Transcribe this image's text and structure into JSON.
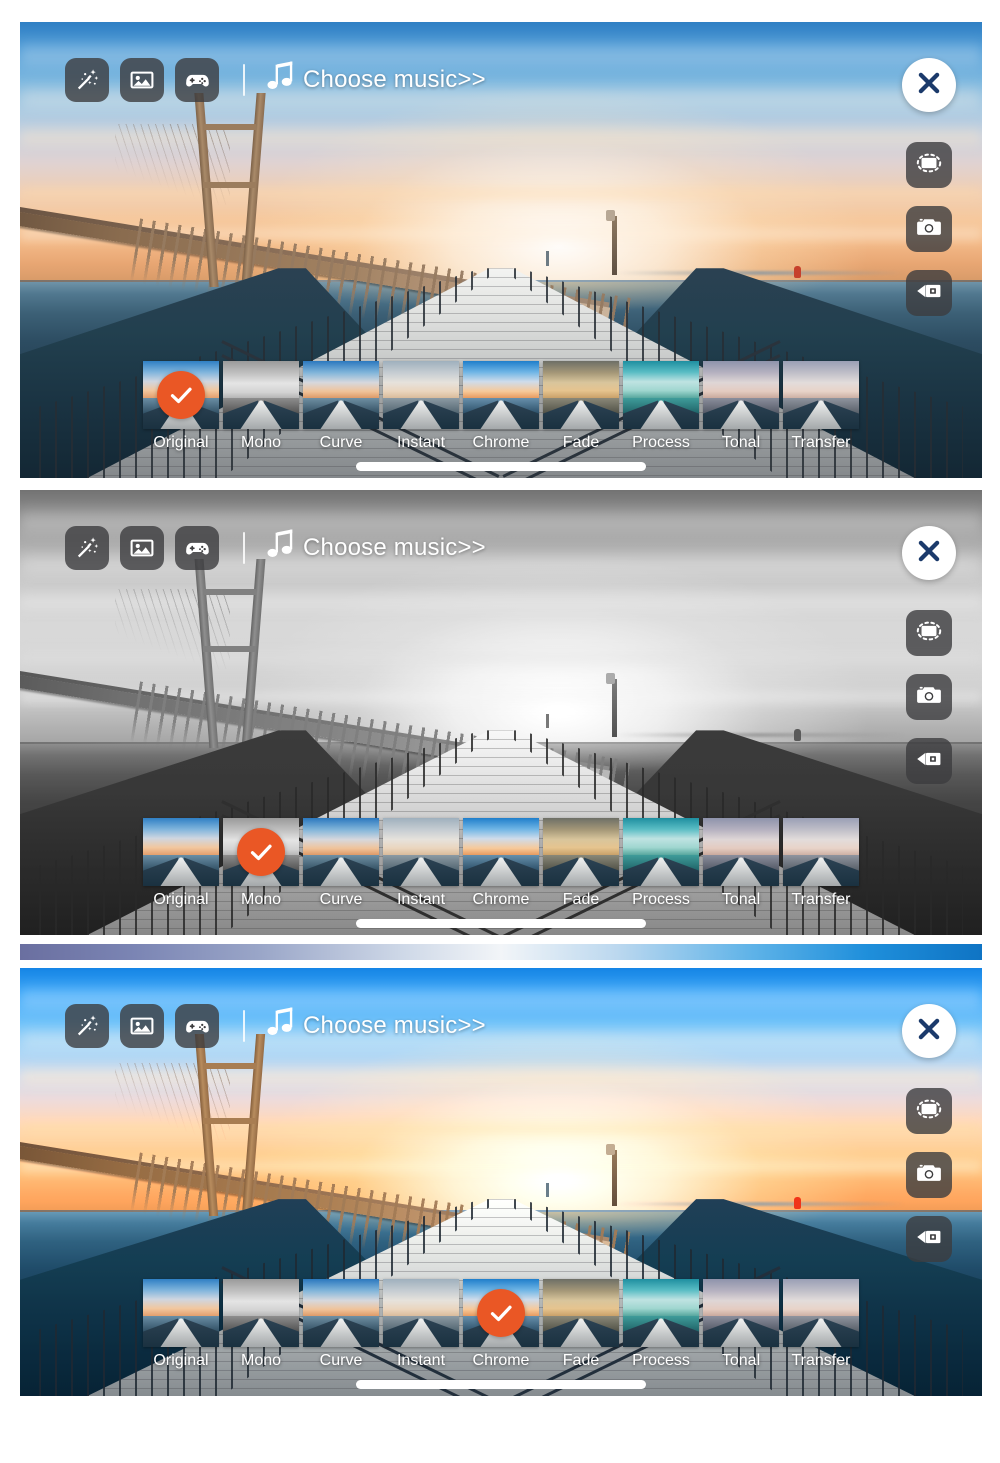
{
  "app": {
    "title": "Video Editor Filter Picker",
    "accent_orange": "#ea5725",
    "close_mark_color": "#1b3a6b",
    "button_bg": "rgba(60,60,62,0.80)"
  },
  "toolbar": {
    "magic_label": "magic-wand",
    "photo_label": "photo",
    "game_label": "game-controller",
    "divider": "|",
    "music_note": "music-note",
    "music_label": "Choose music>>"
  },
  "sidebar": {
    "close_label": "close",
    "rotate_label": "rotate",
    "camera_label": "camera",
    "video_label": "video-camera"
  },
  "filters": {
    "items": [
      {
        "label": "Original",
        "sky": "linear-gradient(180deg,#2f7fc4,#7fb4dc 30%,#cfd6e0 55%,#f2c79e 80%,#e39f6d 100%)",
        "sea": "linear-gradient(180deg,#6a8ea5,#2b4a5e 55%,#182d3c)"
      },
      {
        "label": "Mono",
        "sky": "linear-gradient(180deg,#9a9a9a,#c3c3c3 35%,#e4e4e4 60%,#d2d2d2 85%,#b5b5b5 100%)",
        "sea": "linear-gradient(180deg,#8e8e8e,#4c4c4c 55%,#2c2c2c)"
      },
      {
        "label": "Curve",
        "sky": "linear-gradient(180deg,#2b78bf,#83b6da 32%,#d6d8dd 58%,#f0c39a 82%,#dd9a68 100%)",
        "sea": "linear-gradient(180deg,#6f8fa3,#2c4a5c 55%,#1a2f3d)"
      },
      {
        "label": "Instant",
        "sky": "linear-gradient(180deg,#9fb0bd,#c6cdd2 32%,#e6e2dc 58%,#ead5bd 82%,#d9bb9c 100%)",
        "sea": "linear-gradient(180deg,#8c9aa3,#4b5f6b 55%,#30424d)"
      },
      {
        "label": "Chrome",
        "sky": "linear-gradient(180deg,#1f7ecb,#6fb5e5 30%,#cfdcea 56%,#f7c999 82%,#e79a60 100%)",
        "sea": "linear-gradient(180deg,#678fab,#264a62 55%,#132b3c)"
      },
      {
        "label": "Fade",
        "sky": "linear-gradient(180deg,#6d6f66,#a59878 32%,#d8c59c 58%,#e6c48f 80%,#c9a169 100%)",
        "sea": "linear-gradient(180deg,#8a8878,#4b4c42 55%,#2d2f28)"
      },
      {
        "label": "Process",
        "sky": "linear-gradient(180deg,#1e8fa0,#59bcc4 30%,#bfe3e2 56%,#9fd6cf 80%,#57a79e 100%)",
        "sea": "linear-gradient(180deg,#3f9c9a,#1c5e63 55%,#123f45)"
      },
      {
        "label": "Tonal",
        "sky": "linear-gradient(180deg,#8e93ab,#b6b2c0 32%,#ded6d6 58%,#e4cbc0 82%,#c9a99d 100%)",
        "sea": "linear-gradient(180deg,#8b8e9c,#4d5360 55%,#2f3540)"
      },
      {
        "label": "Transfer",
        "sky": "linear-gradient(180deg,#9a9fb5,#c0bfc8 32%,#e2dcdb 58%,#e8d3c8 82%,#cdb0a4 100%)",
        "sea": "linear-gradient(180deg,#8f949e,#525a63 55%,#333b43)"
      }
    ]
  },
  "panels": [
    {
      "id": "panel-1",
      "selected_filter": "Original",
      "selected_index": 0,
      "filter_mode": "none"
    },
    {
      "id": "panel-2",
      "selected_filter": "Mono",
      "selected_index": 1,
      "filter_mode": "mono"
    },
    {
      "id": "panel-3",
      "selected_filter": "Chrome",
      "selected_index": 4,
      "filter_mode": "chrome"
    }
  ],
  "home_indicator": "home-indicator"
}
